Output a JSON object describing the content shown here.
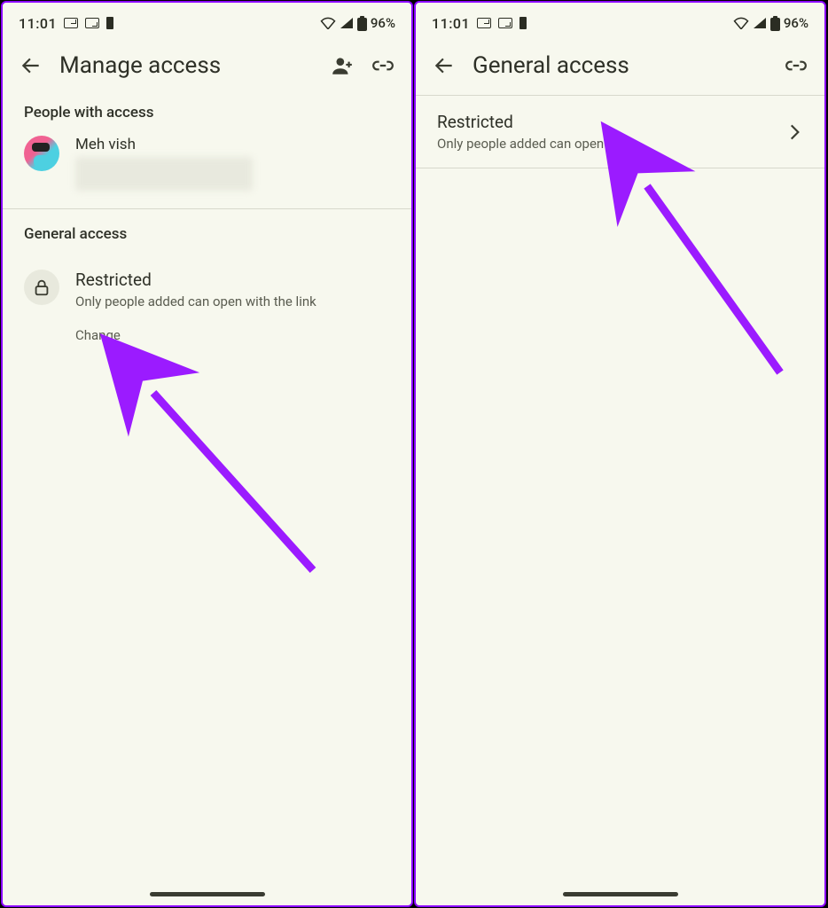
{
  "status": {
    "time": "11:01",
    "battery": "96%"
  },
  "screen1": {
    "title": "Manage access",
    "people_section": "People with access",
    "person_name": "Meh vish",
    "general_section": "General access",
    "restricted_title": "Restricted",
    "restricted_sub": "Only people added can open with the link",
    "change": "Change"
  },
  "screen2": {
    "title": "General access",
    "row_title": "Restricted",
    "row_sub": "Only people added can open"
  }
}
